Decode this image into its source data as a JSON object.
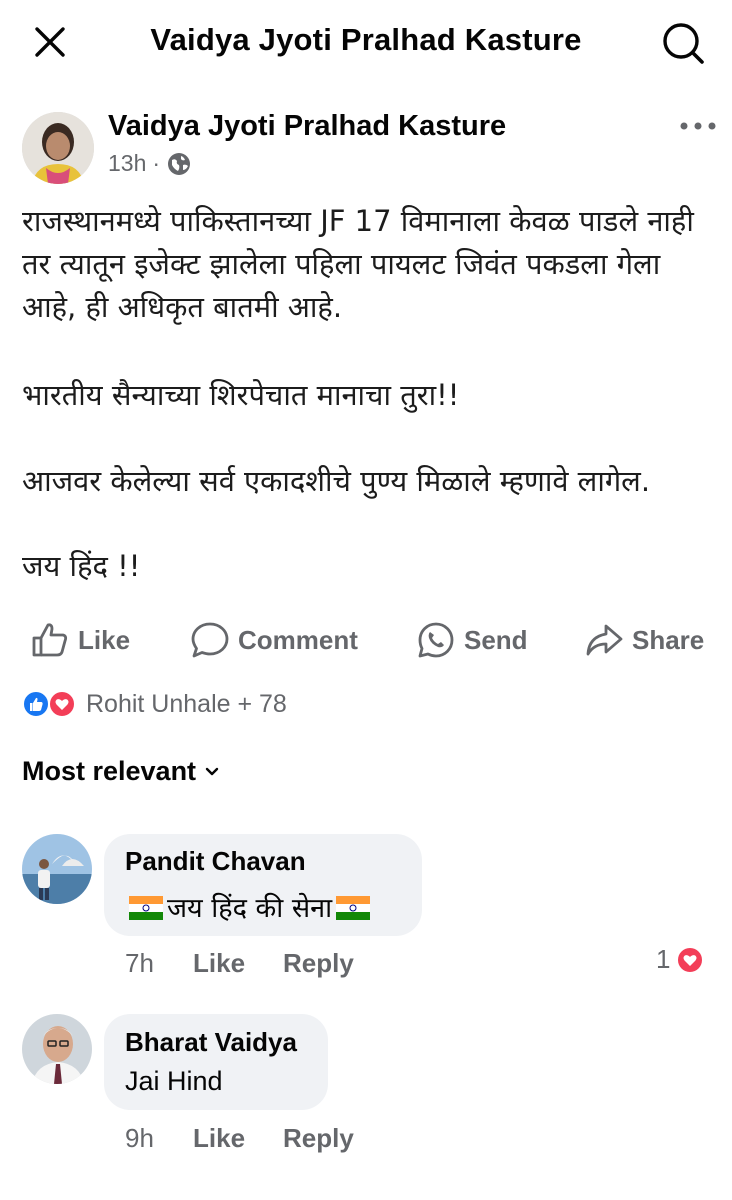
{
  "header": {
    "title": "Vaidya Jyoti Pralhad Kasture",
    "close_icon": "close-icon",
    "search_icon": "search-icon"
  },
  "post": {
    "author": "Vaidya Jyoti Pralhad Kasture",
    "time": "13h",
    "separator": "·",
    "privacy_icon": "globe-icon",
    "paragraphs": [
      "राजस्थानमध्ये  पाकिस्तानच्या JF 17 विमानाला केवळ पाडले नाही तर त्यातून इजेक्ट झालेला पहिला पायलट जिवंत पकडला गेला आहे, ही अधिकृत बातमी आहे.",
      "भारतीय सैन्याच्या शिरपेचात मानाचा तुरा!!",
      "आजवर केलेल्या सर्व एकादशीचे पुण्य मिळाले म्हणावे लागेल.",
      "जय हिंद !!"
    ]
  },
  "actions": {
    "like": "Like",
    "comment": "Comment",
    "send": "Send",
    "share": "Share"
  },
  "reactions": {
    "text": "Rohit Unhale + 78",
    "icons": [
      "like-reaction-icon",
      "love-reaction-icon"
    ]
  },
  "sort": {
    "label": "Most relevant"
  },
  "comments": [
    {
      "name": "Pandit Chavan",
      "text": "जय हिंद की सेना",
      "time": "7h",
      "like": "Like",
      "reply": "Reply",
      "reaction_count": "1",
      "flag_color_top": "#FF9933",
      "flag_color_bottom": "#138808"
    },
    {
      "name": "Bharat Vaidya",
      "text": "Jai Hind",
      "time": "9h",
      "like": "Like",
      "reply": "Reply"
    }
  ],
  "colors": {
    "facebook_blue": "#1877f2",
    "love_red": "#f33e58",
    "muted": "#65676b",
    "bubble": "#f0f2f5"
  }
}
